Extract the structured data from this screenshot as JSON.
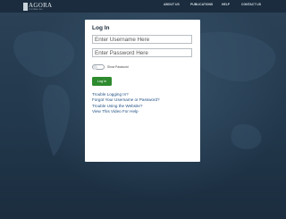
{
  "header": {
    "logo_name": "AGORA",
    "logo_sub": "SYSTEMS INC.",
    "nav": [
      {
        "label": "ABOUT US"
      },
      {
        "label": "PUBLICATIONS"
      },
      {
        "label": "HELP"
      },
      {
        "label": "CONTACT US"
      }
    ]
  },
  "login": {
    "title": "Log In",
    "username_placeholder": "Enter Username Here",
    "password_placeholder": "Enter Password Here",
    "show_password_label": "Show Password",
    "button_label": "Log In",
    "links": [
      {
        "label": "Trouble Logging In?"
      },
      {
        "label": "Forgot Your Username or Password?"
      },
      {
        "label": "Trouble Using the Website?"
      },
      {
        "label": "View This Video For Help"
      }
    ]
  },
  "colors": {
    "background": "#1f3347",
    "topbar": "#1a2c3d",
    "button": "#2e8b2e",
    "link": "#1f4e82"
  }
}
